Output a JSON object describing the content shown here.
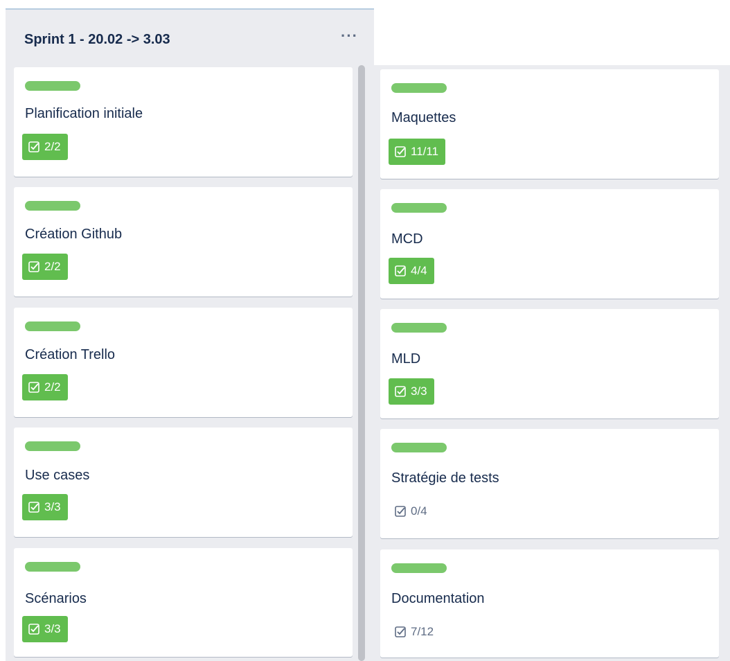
{
  "list": {
    "title": "Sprint 1 - 20.02 -> 3.03",
    "menu_icon": "more-horizontal-icon",
    "menu_label": "···"
  },
  "colors": {
    "label_green": "#7bc86c",
    "badge_complete": "#61bd4f",
    "list_bg": "#ebecf0"
  },
  "cards": [
    {
      "title": "Planification initiale",
      "checklist": "2/2",
      "complete": true
    },
    {
      "title": "Création Github",
      "checklist": "2/2",
      "complete": true
    },
    {
      "title": "Création Trello",
      "checklist": "2/2",
      "complete": true
    },
    {
      "title": "Use cases",
      "checklist": "3/3",
      "complete": true
    },
    {
      "title": "Scénarios",
      "checklist": "3/3",
      "complete": true
    },
    {
      "title": "Maquettes",
      "checklist": "11/11",
      "complete": true
    },
    {
      "title": "MCD",
      "checklist": "4/4",
      "complete": true
    },
    {
      "title": "MLD",
      "checklist": "3/3",
      "complete": true
    },
    {
      "title": "Stratégie de tests",
      "checklist": "0/4",
      "complete": false
    },
    {
      "title": "Documentation",
      "checklist": "7/12",
      "complete": false
    }
  ]
}
